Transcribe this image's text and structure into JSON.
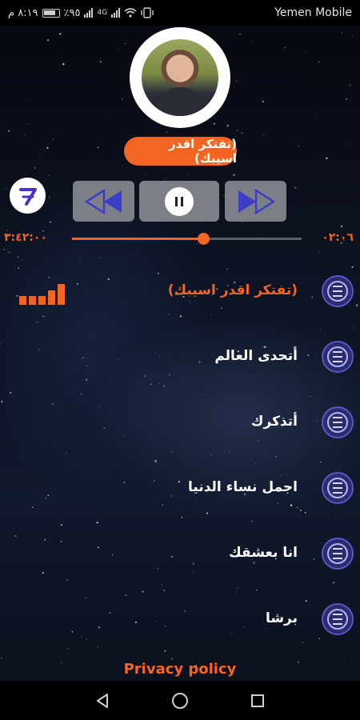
{
  "status_bar": {
    "time": "٨:١٩ م",
    "battery": "٪٩٥",
    "network": "4G",
    "carrier": "Yemen Mobile"
  },
  "player": {
    "now_playing": "(تفتكر اقدر اسيبك)",
    "timer_glyph": "7",
    "total_time": "٣:٤٢:٠٠",
    "current_time": "٠٢:٠٦",
    "progress_fraction": 0.57,
    "accent_color": "#f26522"
  },
  "songs": [
    {
      "title": "(تفتكر اقدر اسيبك)",
      "active": true
    },
    {
      "title": "أتحدى العالم",
      "active": false
    },
    {
      "title": "أتذكرك",
      "active": false
    },
    {
      "title": "اجمل نساء الدنيا",
      "active": false
    },
    {
      "title": "انا بعشقك",
      "active": false
    },
    {
      "title": "برشا",
      "active": false
    }
  ],
  "footer": {
    "privacy_label": "Privacy policy"
  },
  "icons": {
    "timer": "timer-7-icon",
    "prev": "rewind-icon",
    "play": "pause-icon",
    "next": "fast-forward-icon",
    "menu": "menu-lines-icon",
    "nav_back": "back-triangle-icon",
    "nav_home": "home-circle-icon",
    "nav_recent": "recents-square-icon"
  }
}
